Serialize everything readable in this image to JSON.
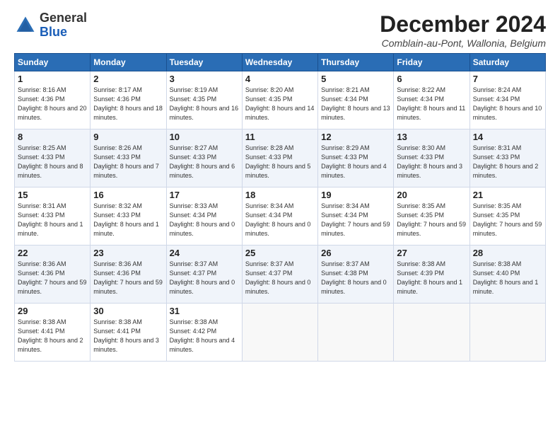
{
  "header": {
    "logo_general": "General",
    "logo_blue": "Blue",
    "month_title": "December 2024",
    "location": "Comblain-au-Pont, Wallonia, Belgium"
  },
  "days_of_week": [
    "Sunday",
    "Monday",
    "Tuesday",
    "Wednesday",
    "Thursday",
    "Friday",
    "Saturday"
  ],
  "weeks": [
    [
      {
        "day": 1,
        "sunrise": "8:16 AM",
        "sunset": "4:36 PM",
        "daylight": "8 hours and 20 minutes"
      },
      {
        "day": 2,
        "sunrise": "8:17 AM",
        "sunset": "4:36 PM",
        "daylight": "8 hours and 18 minutes"
      },
      {
        "day": 3,
        "sunrise": "8:19 AM",
        "sunset": "4:35 PM",
        "daylight": "8 hours and 16 minutes"
      },
      {
        "day": 4,
        "sunrise": "8:20 AM",
        "sunset": "4:35 PM",
        "daylight": "8 hours and 14 minutes"
      },
      {
        "day": 5,
        "sunrise": "8:21 AM",
        "sunset": "4:34 PM",
        "daylight": "8 hours and 13 minutes"
      },
      {
        "day": 6,
        "sunrise": "8:22 AM",
        "sunset": "4:34 PM",
        "daylight": "8 hours and 11 minutes"
      },
      {
        "day": 7,
        "sunrise": "8:24 AM",
        "sunset": "4:34 PM",
        "daylight": "8 hours and 10 minutes"
      }
    ],
    [
      {
        "day": 8,
        "sunrise": "8:25 AM",
        "sunset": "4:33 PM",
        "daylight": "8 hours and 8 minutes"
      },
      {
        "day": 9,
        "sunrise": "8:26 AM",
        "sunset": "4:33 PM",
        "daylight": "8 hours and 7 minutes"
      },
      {
        "day": 10,
        "sunrise": "8:27 AM",
        "sunset": "4:33 PM",
        "daylight": "8 hours and 6 minutes"
      },
      {
        "day": 11,
        "sunrise": "8:28 AM",
        "sunset": "4:33 PM",
        "daylight": "8 hours and 5 minutes"
      },
      {
        "day": 12,
        "sunrise": "8:29 AM",
        "sunset": "4:33 PM",
        "daylight": "8 hours and 4 minutes"
      },
      {
        "day": 13,
        "sunrise": "8:30 AM",
        "sunset": "4:33 PM",
        "daylight": "8 hours and 3 minutes"
      },
      {
        "day": 14,
        "sunrise": "8:31 AM",
        "sunset": "4:33 PM",
        "daylight": "8 hours and 2 minutes"
      }
    ],
    [
      {
        "day": 15,
        "sunrise": "8:31 AM",
        "sunset": "4:33 PM",
        "daylight": "8 hours and 1 minute"
      },
      {
        "day": 16,
        "sunrise": "8:32 AM",
        "sunset": "4:33 PM",
        "daylight": "8 hours and 1 minute"
      },
      {
        "day": 17,
        "sunrise": "8:33 AM",
        "sunset": "4:34 PM",
        "daylight": "8 hours and 0 minutes"
      },
      {
        "day": 18,
        "sunrise": "8:34 AM",
        "sunset": "4:34 PM",
        "daylight": "8 hours and 0 minutes"
      },
      {
        "day": 19,
        "sunrise": "8:34 AM",
        "sunset": "4:34 PM",
        "daylight": "7 hours and 59 minutes"
      },
      {
        "day": 20,
        "sunrise": "8:35 AM",
        "sunset": "4:35 PM",
        "daylight": "7 hours and 59 minutes"
      },
      {
        "day": 21,
        "sunrise": "8:35 AM",
        "sunset": "4:35 PM",
        "daylight": "7 hours and 59 minutes"
      }
    ],
    [
      {
        "day": 22,
        "sunrise": "8:36 AM",
        "sunset": "4:36 PM",
        "daylight": "7 hours and 59 minutes"
      },
      {
        "day": 23,
        "sunrise": "8:36 AM",
        "sunset": "4:36 PM",
        "daylight": "7 hours and 59 minutes"
      },
      {
        "day": 24,
        "sunrise": "8:37 AM",
        "sunset": "4:37 PM",
        "daylight": "8 hours and 0 minutes"
      },
      {
        "day": 25,
        "sunrise": "8:37 AM",
        "sunset": "4:37 PM",
        "daylight": "8 hours and 0 minutes"
      },
      {
        "day": 26,
        "sunrise": "8:37 AM",
        "sunset": "4:38 PM",
        "daylight": "8 hours and 0 minutes"
      },
      {
        "day": 27,
        "sunrise": "8:38 AM",
        "sunset": "4:39 PM",
        "daylight": "8 hours and 1 minute"
      },
      {
        "day": 28,
        "sunrise": "8:38 AM",
        "sunset": "4:40 PM",
        "daylight": "8 hours and 1 minute"
      }
    ],
    [
      {
        "day": 29,
        "sunrise": "8:38 AM",
        "sunset": "4:41 PM",
        "daylight": "8 hours and 2 minutes"
      },
      {
        "day": 30,
        "sunrise": "8:38 AM",
        "sunset": "4:41 PM",
        "daylight": "8 hours and 3 minutes"
      },
      {
        "day": 31,
        "sunrise": "8:38 AM",
        "sunset": "4:42 PM",
        "daylight": "8 hours and 4 minutes"
      },
      null,
      null,
      null,
      null
    ]
  ]
}
